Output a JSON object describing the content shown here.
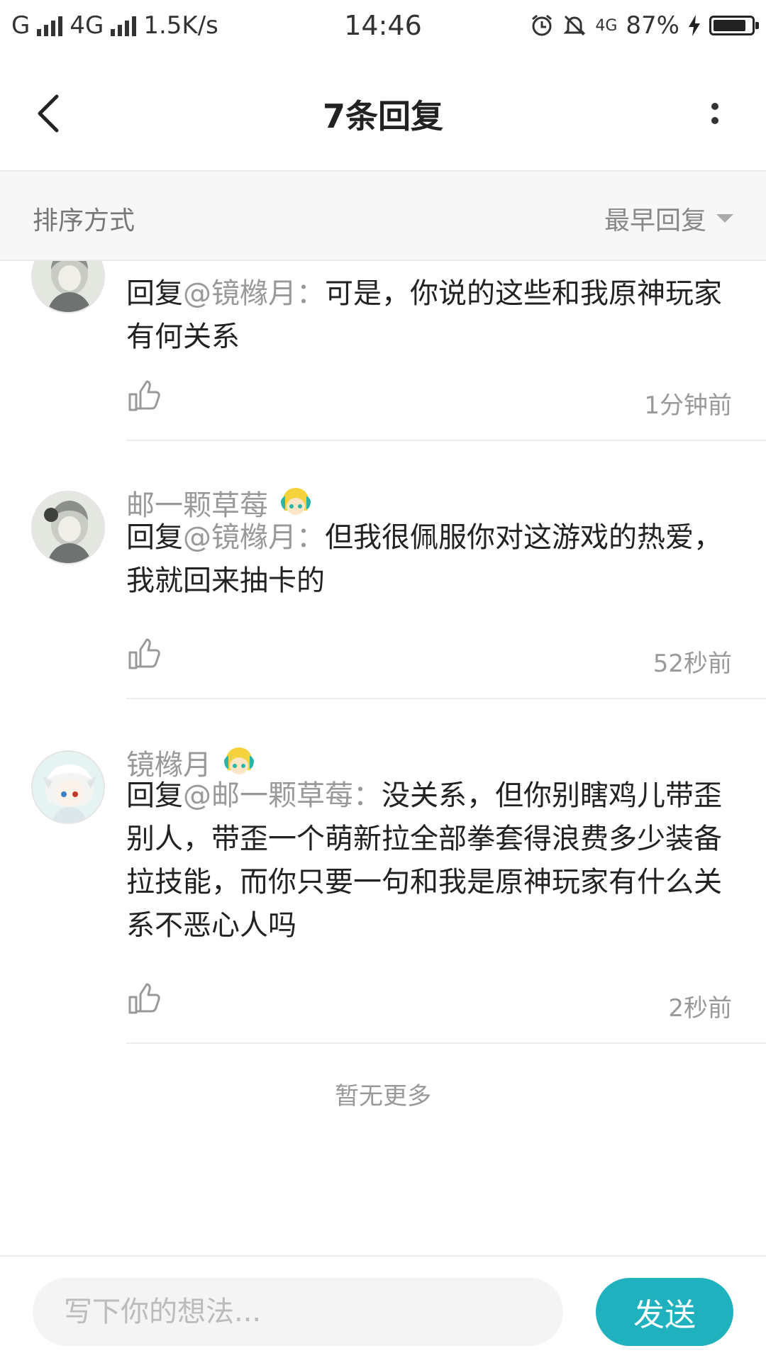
{
  "status_bar": {
    "carrier": "G",
    "network": "4G",
    "speed": "1.5K/s",
    "time": "14:46",
    "net2": "4G",
    "battery": "87%",
    "battery_level": 0.87
  },
  "header": {
    "title": "7条回复"
  },
  "sort": {
    "label": "排序方式",
    "value": "最早回复"
  },
  "replies": [
    {
      "prefix": "回复",
      "mention": "@镜橼月",
      "colon": "：",
      "text": "可是，你说的这些和我原神玩家有何关系",
      "time": "1分钟前"
    },
    {
      "username": "邮一颗草莓",
      "prefix": "回复",
      "mention": "@镜橼月",
      "colon": "：",
      "text": "但我很佩服你对这游戏的热爱，我就回来抽卡的",
      "time": "52秒前"
    },
    {
      "username": "镜橼月",
      "prefix": "回复",
      "mention": "@邮一颗草莓",
      "colon": "：",
      "text": "没关系，但你别瞎鸡儿带歪别人，带歪一个萌新拉全部拳套得浪费多少装备拉技能，而你只要一句和我是原神玩家有什么关系不恶心人吗",
      "time": "2秒前"
    }
  ],
  "footer_note": "暂无更多",
  "composer": {
    "placeholder": "写下你的想法...",
    "send_label": "发送"
  },
  "colors": {
    "accent": "#1fb1bd",
    "muted": "#999999"
  },
  "icons": [
    "back-arrow-icon",
    "more-vertical-icon",
    "caret-down-icon",
    "thumbs-up-icon",
    "avatar",
    "badge-icon",
    "alarm-icon",
    "mute-icon",
    "battery-icon",
    "charging-icon"
  ]
}
